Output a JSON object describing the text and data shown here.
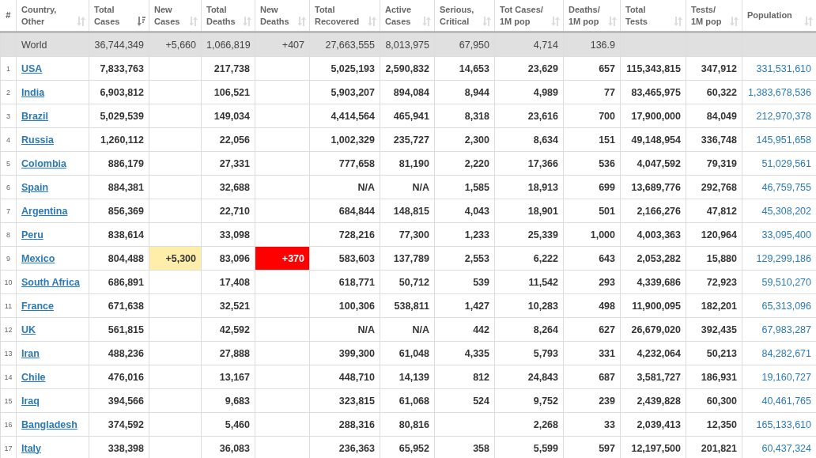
{
  "table": {
    "columns": [
      {
        "label": "#",
        "sorted": false,
        "sortable": false
      },
      {
        "label": "Country,\nOther",
        "sorted": false,
        "sortable": true
      },
      {
        "label": "Total\nCases",
        "sorted": true,
        "sortable": true
      },
      {
        "label": "New\nCases",
        "sorted": false,
        "sortable": true
      },
      {
        "label": "Total\nDeaths",
        "sorted": false,
        "sortable": true
      },
      {
        "label": "New\nDeaths",
        "sorted": false,
        "sortable": true
      },
      {
        "label": "Total\nRecovered",
        "sorted": false,
        "sortable": true
      },
      {
        "label": "Active\nCases",
        "sorted": false,
        "sortable": true
      },
      {
        "label": "Serious,\nCritical",
        "sorted": false,
        "sortable": true
      },
      {
        "label": "Tot Cases/\n1M pop",
        "sorted": false,
        "sortable": true
      },
      {
        "label": "Deaths/\n1M pop",
        "sorted": false,
        "sortable": true
      },
      {
        "label": "Total\nTests",
        "sorted": false,
        "sortable": true
      },
      {
        "label": "Tests/\n1M pop",
        "sorted": false,
        "sortable": true
      },
      {
        "label": "Population",
        "sorted": false,
        "sortable": true
      }
    ],
    "rows": [
      {
        "kind": "total",
        "cells": [
          "",
          "World",
          "36,744,349",
          "+5,660",
          "1,066,819",
          "+407",
          "27,663,555",
          "8,013,975",
          "67,950",
          "4,714",
          "136.9",
          "",
          "",
          ""
        ]
      },
      {
        "kind": "country",
        "cells": [
          "1",
          "USA",
          "7,833,763",
          "",
          "217,738",
          "",
          "5,025,193",
          "2,590,832",
          "14,653",
          "23,629",
          "657",
          "115,343,815",
          "347,912",
          "331,531,610"
        ]
      },
      {
        "kind": "country",
        "cells": [
          "2",
          "India",
          "6,903,812",
          "",
          "106,521",
          "",
          "5,903,207",
          "894,084",
          "8,944",
          "4,989",
          "77",
          "83,465,975",
          "60,322",
          "1,383,678,536"
        ]
      },
      {
        "kind": "country",
        "cells": [
          "3",
          "Brazil",
          "5,029,539",
          "",
          "149,034",
          "",
          "4,414,564",
          "465,941",
          "8,318",
          "23,616",
          "700",
          "17,900,000",
          "84,049",
          "212,970,378"
        ]
      },
      {
        "kind": "country",
        "cells": [
          "4",
          "Russia",
          "1,260,112",
          "",
          "22,056",
          "",
          "1,002,329",
          "235,727",
          "2,300",
          "8,634",
          "151",
          "49,148,954",
          "336,748",
          "145,951,658"
        ]
      },
      {
        "kind": "country",
        "cells": [
          "5",
          "Colombia",
          "886,179",
          "",
          "27,331",
          "",
          "777,658",
          "81,190",
          "2,220",
          "17,366",
          "536",
          "4,047,592",
          "79,319",
          "51,029,561"
        ]
      },
      {
        "kind": "country",
        "cells": [
          "6",
          "Spain",
          "884,381",
          "",
          "32,688",
          "",
          "N/A",
          "N/A",
          "1,585",
          "18,913",
          "699",
          "13,689,776",
          "292,768",
          "46,759,755"
        ]
      },
      {
        "kind": "country",
        "cells": [
          "7",
          "Argentina",
          "856,369",
          "",
          "22,710",
          "",
          "684,844",
          "148,815",
          "4,043",
          "18,901",
          "501",
          "2,166,276",
          "47,812",
          "45,308,202"
        ]
      },
      {
        "kind": "country",
        "cells": [
          "8",
          "Peru",
          "838,614",
          "",
          "33,098",
          "",
          "728,216",
          "77,300",
          "1,233",
          "25,339",
          "1,000",
          "4,003,363",
          "120,964",
          "33,095,400"
        ]
      },
      {
        "kind": "country",
        "cells": [
          "9",
          "Mexico",
          "804,488",
          {
            "text": "+5,300",
            "color": "#ffeeaa"
          },
          "83,096",
          {
            "text": "+370",
            "color": "#ff0000"
          },
          "583,603",
          "137,789",
          "2,553",
          "6,222",
          "643",
          "2,053,282",
          "15,880",
          "129,299,186"
        ]
      },
      {
        "kind": "country",
        "cells": [
          "10",
          "South Africa",
          "686,891",
          "",
          "17,408",
          "",
          "618,771",
          "50,712",
          "539",
          "11,542",
          "293",
          "4,339,686",
          "72,923",
          "59,510,270"
        ]
      },
      {
        "kind": "country",
        "cells": [
          "11",
          "France",
          "671,638",
          "",
          "32,521",
          "",
          "100,306",
          "538,811",
          "1,427",
          "10,283",
          "498",
          "11,900,095",
          "182,201",
          "65,313,096"
        ]
      },
      {
        "kind": "country",
        "cells": [
          "12",
          "UK",
          "561,815",
          "",
          "42,592",
          "",
          "N/A",
          "N/A",
          "442",
          "8,264",
          "627",
          "26,679,020",
          "392,435",
          "67,983,287"
        ]
      },
      {
        "kind": "country",
        "cells": [
          "13",
          "Iran",
          "488,236",
          "",
          "27,888",
          "",
          "399,300",
          "61,048",
          "4,335",
          "5,793",
          "331",
          "4,232,064",
          "50,213",
          "84,282,671"
        ]
      },
      {
        "kind": "country",
        "cells": [
          "14",
          "Chile",
          "476,016",
          "",
          "13,167",
          "",
          "448,710",
          "14,139",
          "812",
          "24,843",
          "687",
          "3,581,727",
          "186,931",
          "19,160,727"
        ]
      },
      {
        "kind": "country",
        "cells": [
          "15",
          "Iraq",
          "394,566",
          "",
          "9,683",
          "",
          "323,815",
          "61,068",
          "524",
          "9,752",
          "239",
          "2,439,828",
          "60,300",
          "40,461,765"
        ]
      },
      {
        "kind": "country",
        "cells": [
          "16",
          "Bangladesh",
          "374,592",
          "",
          "5,460",
          "",
          "288,316",
          "80,816",
          "",
          "2,268",
          "33",
          "2,039,413",
          "12,350",
          "165,133,610"
        ]
      },
      {
        "kind": "country",
        "cells": [
          "17",
          "Italy",
          "338,398",
          "",
          "36,083",
          "",
          "236,363",
          "65,952",
          "358",
          "5,599",
          "597",
          "12,197,500",
          "201,821",
          "60,437,324"
        ]
      }
    ]
  }
}
